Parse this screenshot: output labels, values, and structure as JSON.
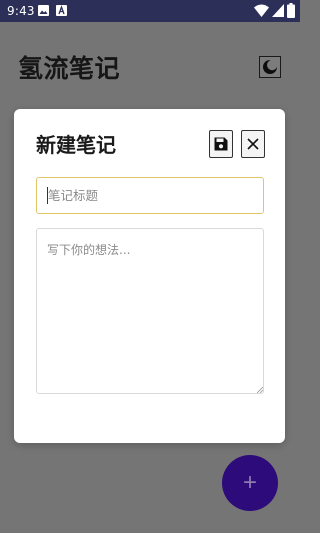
{
  "status_bar": {
    "time": "9:43",
    "icons": [
      "image-icon",
      "a-icon",
      "wifi-icon",
      "signal-icon",
      "battery-icon"
    ]
  },
  "app": {
    "title": "氢流笔记",
    "theme_toggle_icon": "moon-icon",
    "fab_label": "+"
  },
  "modal": {
    "title": "新建笔记",
    "save_icon": "save-icon",
    "close_icon": "close-icon",
    "title_input": {
      "value": "",
      "placeholder": "笔记标题"
    },
    "content_input": {
      "value": "",
      "placeholder": "写下你的想法..."
    }
  },
  "colors": {
    "status_bar": "#2c2f57",
    "scrim": "#757575",
    "fab": "#2d0b7a",
    "focus_border": "#e2c56b"
  }
}
